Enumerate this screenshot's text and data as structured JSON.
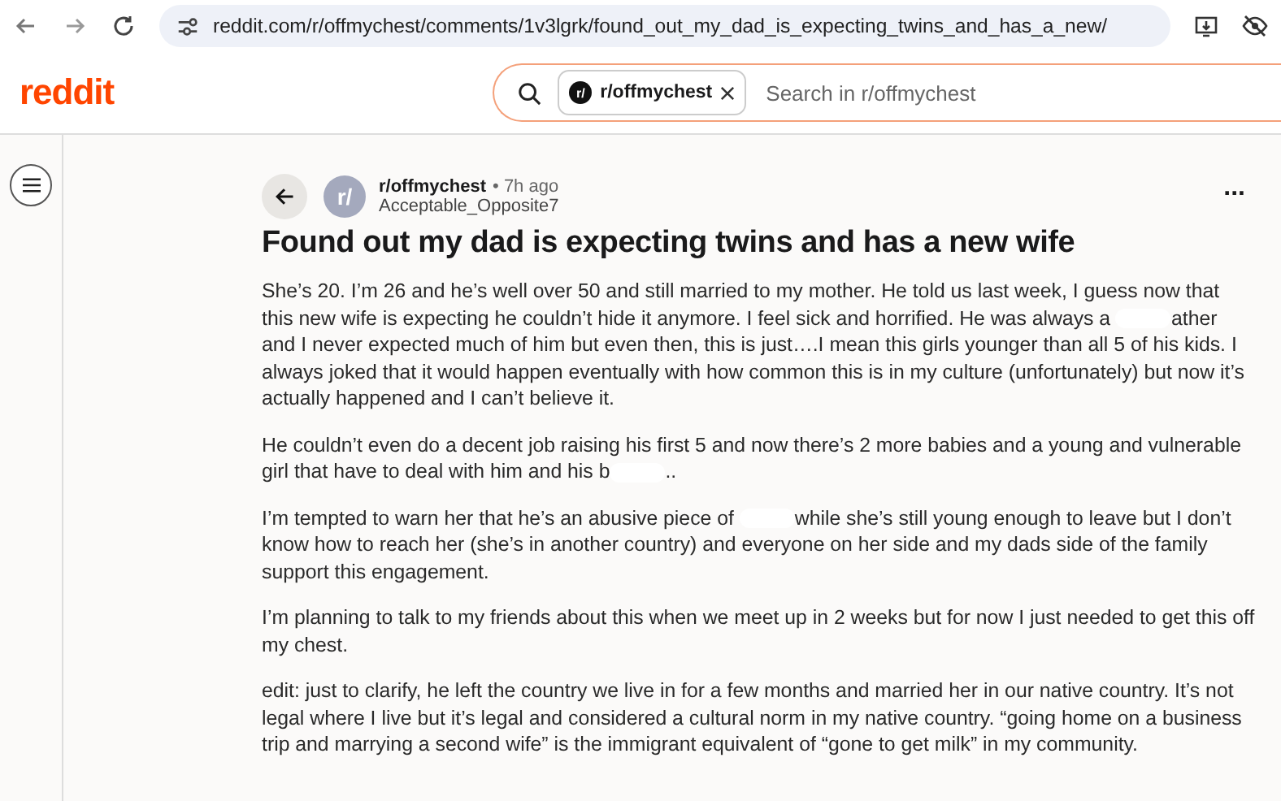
{
  "browser": {
    "url": "reddit.com/r/offmychest/comments/1v3lgrk/found_out_my_dad_is_expecting_twins_and_has_a_new/"
  },
  "header": {
    "logo": "reddit",
    "search": {
      "chip": "r/offmychest",
      "chip_icon": "r/",
      "placeholder": "Search in r/offmychest"
    }
  },
  "post": {
    "avatar": "r/",
    "subreddit": "r/offmychest",
    "age": "• 7h ago",
    "author": "Acceptable_Opposite7",
    "more": "...",
    "title": "Found out my dad is expecting twins and has a new wife",
    "paragraphs": [
      [
        {
          "kind": "text",
          "text": "She’s 20. I’m 26 and he’s well over 50 and still married to my mother. He told us last week, I guess now that this new wife is expecting he couldn’t hide it anymore. I feel sick and horrified. He was always a "
        },
        {
          "kind": "redaction"
        },
        {
          "kind": "text",
          "text": "ather and I never expected much of him but even then, this is just….I mean this girls younger than all 5 of his kids. I always joked that it would happen eventually with how common this is in my culture (unfortunately) but now it’s actually happened and I can’t believe it."
        }
      ],
      [
        {
          "kind": "text",
          "text": "He couldn’t even do a decent job raising his first 5 and now there’s 2 more babies and a young and vulnerable girl that have to deal with him and his b"
        },
        {
          "kind": "redaction"
        },
        {
          "kind": "text",
          "text": ".."
        }
      ],
      [
        {
          "kind": "text",
          "text": "I’m tempted to warn her that he’s an abusive piece of "
        },
        {
          "kind": "redaction"
        },
        {
          "kind": "text",
          "text": "while she’s still young enough to leave but I don’t know how to reach her (she’s in another country) and everyone on her side and my dads side of the family support this engagement."
        }
      ],
      [
        {
          "kind": "text",
          "text": "I’m planning to talk to my friends about this when we meet up in 2 weeks but for now I just needed to get this off my chest."
        }
      ],
      [
        {
          "kind": "text",
          "text": "edit: just to clarify, he left the country we live in for a few months and married her in our native country. It’s not legal where I live but it’s legal and considered a cultural norm in my native country. “going home on a business trip and marrying a second wife” is the immigrant equivalent of “gone to get milk” in my community."
        }
      ]
    ]
  }
}
